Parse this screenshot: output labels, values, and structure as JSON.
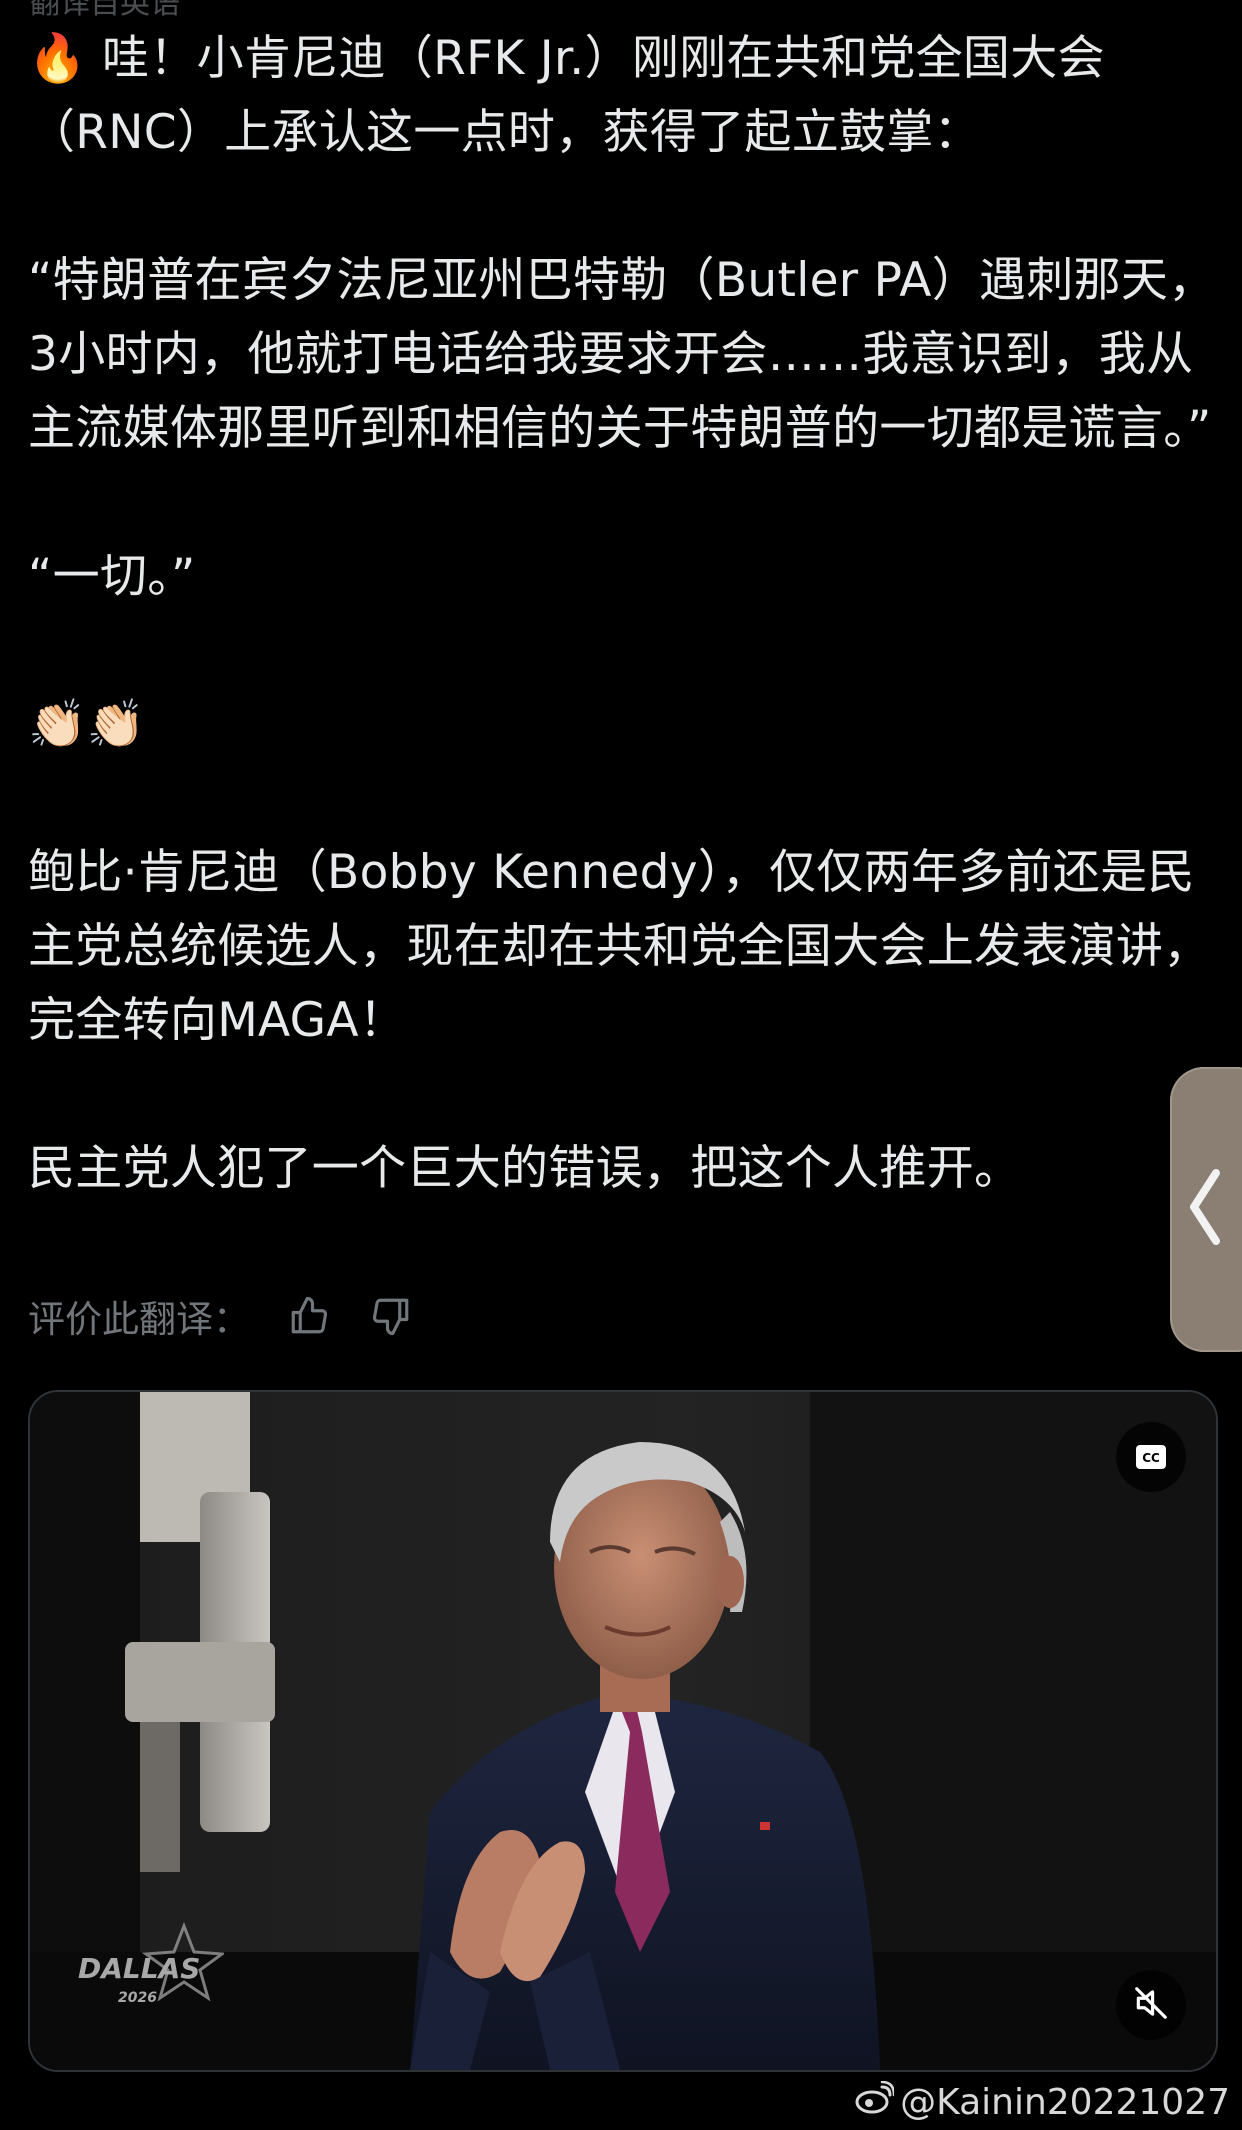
{
  "top_clip": "翻译自英语",
  "tweet": {
    "paragraph_1": "🔥 哇！小肯尼迪（RFK Jr.）刚刚在共和党全国大会（RNC）上承认这一点时，获得了起立鼓掌：",
    "paragraph_2": "“特朗普在宾夕法尼亚州巴特勒（Butler PA）遇刺那天，3小时内，他就打电话给我要求开会……我意识到，我从主流媒体那里听到和相信的关于特朗普的一切都是谎言。”",
    "paragraph_3": "“一切。”",
    "paragraph_4": "👏🏻👏🏻",
    "paragraph_5": "鲍比·肯尼迪（Bobby Kennedy），仅仅两年多前还是民主党总统候选人，现在却在共和党全国大会上发表演讲，完全转向MAGA！",
    "paragraph_6": "民主党人犯了一个巨大的错误，把这个人推开。"
  },
  "rate_translation": {
    "label": "评价此翻译："
  },
  "video": {
    "logo_text": "DALLAS",
    "logo_year": "2026",
    "cc_label": "CC"
  },
  "watermark": {
    "handle": "@Kainin20221027"
  },
  "colors": {
    "background": "#000000",
    "text": "#e7e9ea",
    "muted": "#71767b",
    "handle_bg": "#8a7f72"
  }
}
